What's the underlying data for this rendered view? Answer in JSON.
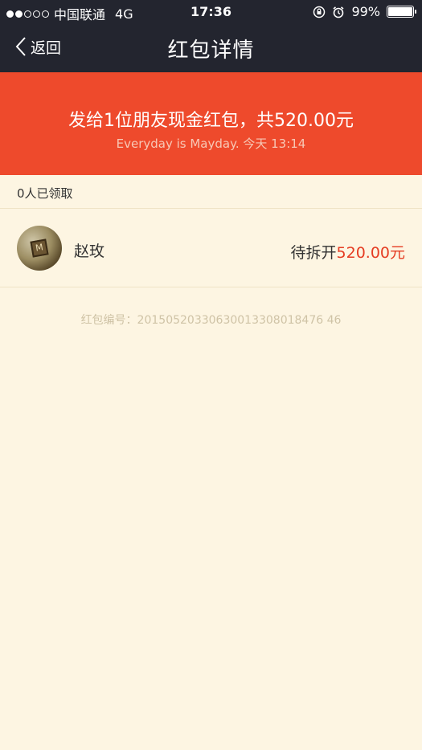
{
  "status": {
    "carrier": "中国联通",
    "network": "4G",
    "time": "17:36",
    "battery": "99%",
    "battery_level": 0.99,
    "signal_filled": 2,
    "signal_total": 5
  },
  "nav": {
    "back_label": "返回",
    "title": "红包详情"
  },
  "banner": {
    "title": "发给1位朋友现金红包，共520.00元",
    "subtitle": "Everyday is Mayday. 今天 13:14"
  },
  "received_summary": "0人已领取",
  "recipients": [
    {
      "name": "赵玫",
      "status": "待拆开",
      "amount": "520.00元"
    }
  ],
  "serial": "红包编号：20150520330630013308018476 46",
  "colors": {
    "bar": "#23252f",
    "banner": "#ee4a2c",
    "page_bg": "#fdf5e2",
    "amount": "#e53c22"
  }
}
